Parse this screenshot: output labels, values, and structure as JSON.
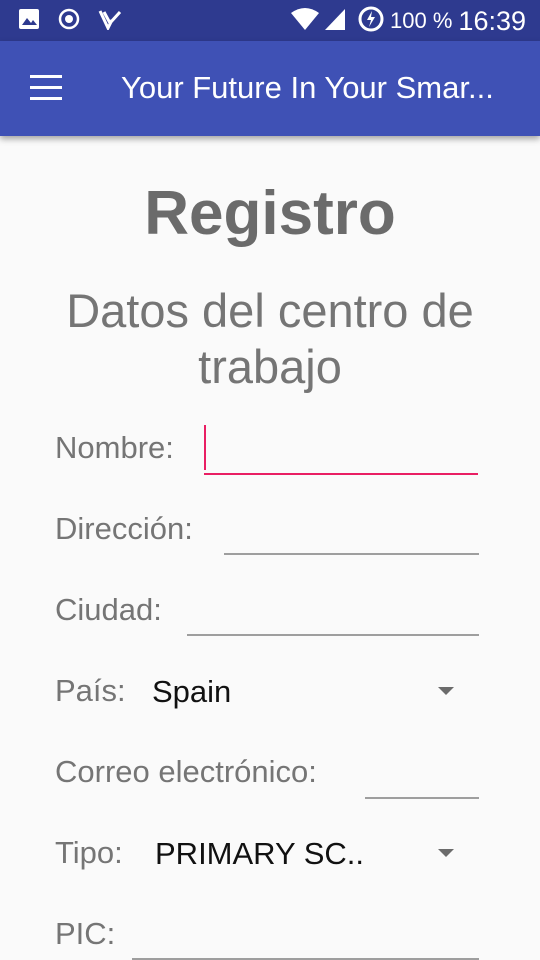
{
  "status_bar": {
    "icons": [
      "image-icon",
      "record-icon",
      "check-icon",
      "wifi-icon",
      "signal-icon",
      "battery-icon"
    ],
    "battery": "100 %",
    "time": "16:39"
  },
  "app_bar": {
    "menu_icon": "hamburger-menu-icon",
    "title": "Your Future In Your Smar..."
  },
  "header": {
    "title": "Registro",
    "subtitle": "Datos del centro de trabajo"
  },
  "form": {
    "nombre_label": "Nombre:",
    "direccion_label": "Dirección:",
    "ciudad_label": "Ciudad:",
    "pais_label": "País:",
    "pais_value": "Spain",
    "correo_label": "Correo electrónico:",
    "tipo_label": "Tipo:",
    "tipo_value": "PRIMARY SC..",
    "pic_label": "PIC:"
  },
  "colors": {
    "status_bar": "#2e3a8f",
    "app_bar": "#3f51b5",
    "accent": "#e91e63"
  }
}
